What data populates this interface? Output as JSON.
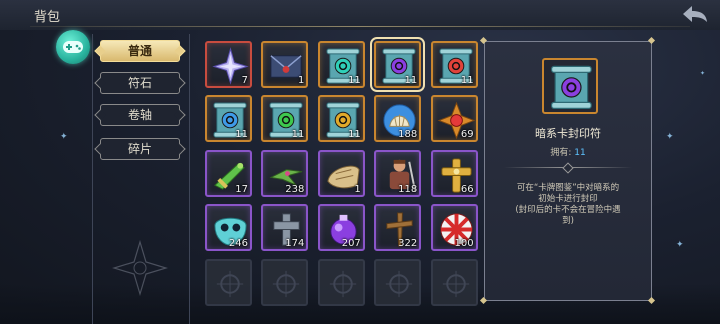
{
  "header": {
    "title": "背包"
  },
  "nav": {
    "tabs": [
      {
        "label": "普通",
        "active": true
      },
      {
        "label": "符石",
        "active": false
      },
      {
        "label": "卷轴",
        "active": false
      },
      {
        "label": "碎片",
        "active": false
      }
    ]
  },
  "inventory": {
    "slots": [
      {
        "icon": "star-crystal-icon",
        "count": "7",
        "rarity": "red"
      },
      {
        "icon": "sealed-letter-icon",
        "count": "1",
        "rarity": "orange"
      },
      {
        "icon": "scroll-teal-rune-icon",
        "count": "11",
        "rarity": "orange"
      },
      {
        "icon": "scroll-purple-rune-icon",
        "count": "11",
        "rarity": "orange",
        "selected": true
      },
      {
        "icon": "scroll-red-rune-icon",
        "count": "11",
        "rarity": "orange"
      },
      {
        "icon": "scroll-blue-rune-icon",
        "count": "11",
        "rarity": "orange"
      },
      {
        "icon": "scroll-green-rune-icon",
        "count": "11",
        "rarity": "orange"
      },
      {
        "icon": "scroll-gold-rune-icon",
        "count": "11",
        "rarity": "orange"
      },
      {
        "icon": "shell-emblem-icon",
        "count": "188",
        "rarity": "orange"
      },
      {
        "icon": "ornate-cross-gem-icon",
        "count": "69",
        "rarity": "orange"
      },
      {
        "icon": "green-dagger-icon",
        "count": "17",
        "rarity": "purple"
      },
      {
        "icon": "green-bird-icon",
        "count": "238",
        "rarity": "purple"
      },
      {
        "icon": "bread-icon",
        "count": "1",
        "rarity": "purple"
      },
      {
        "icon": "warrior-figure-icon",
        "count": "118",
        "rarity": "purple"
      },
      {
        "icon": "gold-cross-icon",
        "count": "66",
        "rarity": "purple"
      },
      {
        "icon": "teal-mask-icon",
        "count": "246",
        "rarity": "purple"
      },
      {
        "icon": "stone-cross-icon",
        "count": "174",
        "rarity": "purple"
      },
      {
        "icon": "purple-potion-icon",
        "count": "207",
        "rarity": "purple"
      },
      {
        "icon": "wooden-cross-icon",
        "count": "322",
        "rarity": "purple"
      },
      {
        "icon": "peppermint-candy-icon",
        "count": "100",
        "rarity": "purple"
      },
      {
        "icon": "empty-slot-icon",
        "count": "",
        "rarity": "empty"
      },
      {
        "icon": "empty-slot-icon",
        "count": "",
        "rarity": "empty"
      },
      {
        "icon": "empty-slot-icon",
        "count": "",
        "rarity": "empty"
      },
      {
        "icon": "empty-slot-icon",
        "count": "",
        "rarity": "empty"
      },
      {
        "icon": "empty-slot-icon",
        "count": "",
        "rarity": "empty"
      }
    ]
  },
  "detail": {
    "icon": "scroll-purple-rune-icon",
    "name": "暗系卡封印符",
    "owned_label": "拥有:",
    "owned_value": "11",
    "desc_lines": [
      "可在“卡牌图鉴”中对暗系的",
      "初始卡进行封印",
      "(封印后的卡不会在冒险中遇",
      "到)"
    ]
  },
  "colors": {
    "accent_gold": "#d9b96e",
    "rare_orange": "#c9862f",
    "rare_purple": "#8a55c9",
    "rare_red": "#c84c3f",
    "owned_blue": "#5ec3ff"
  }
}
